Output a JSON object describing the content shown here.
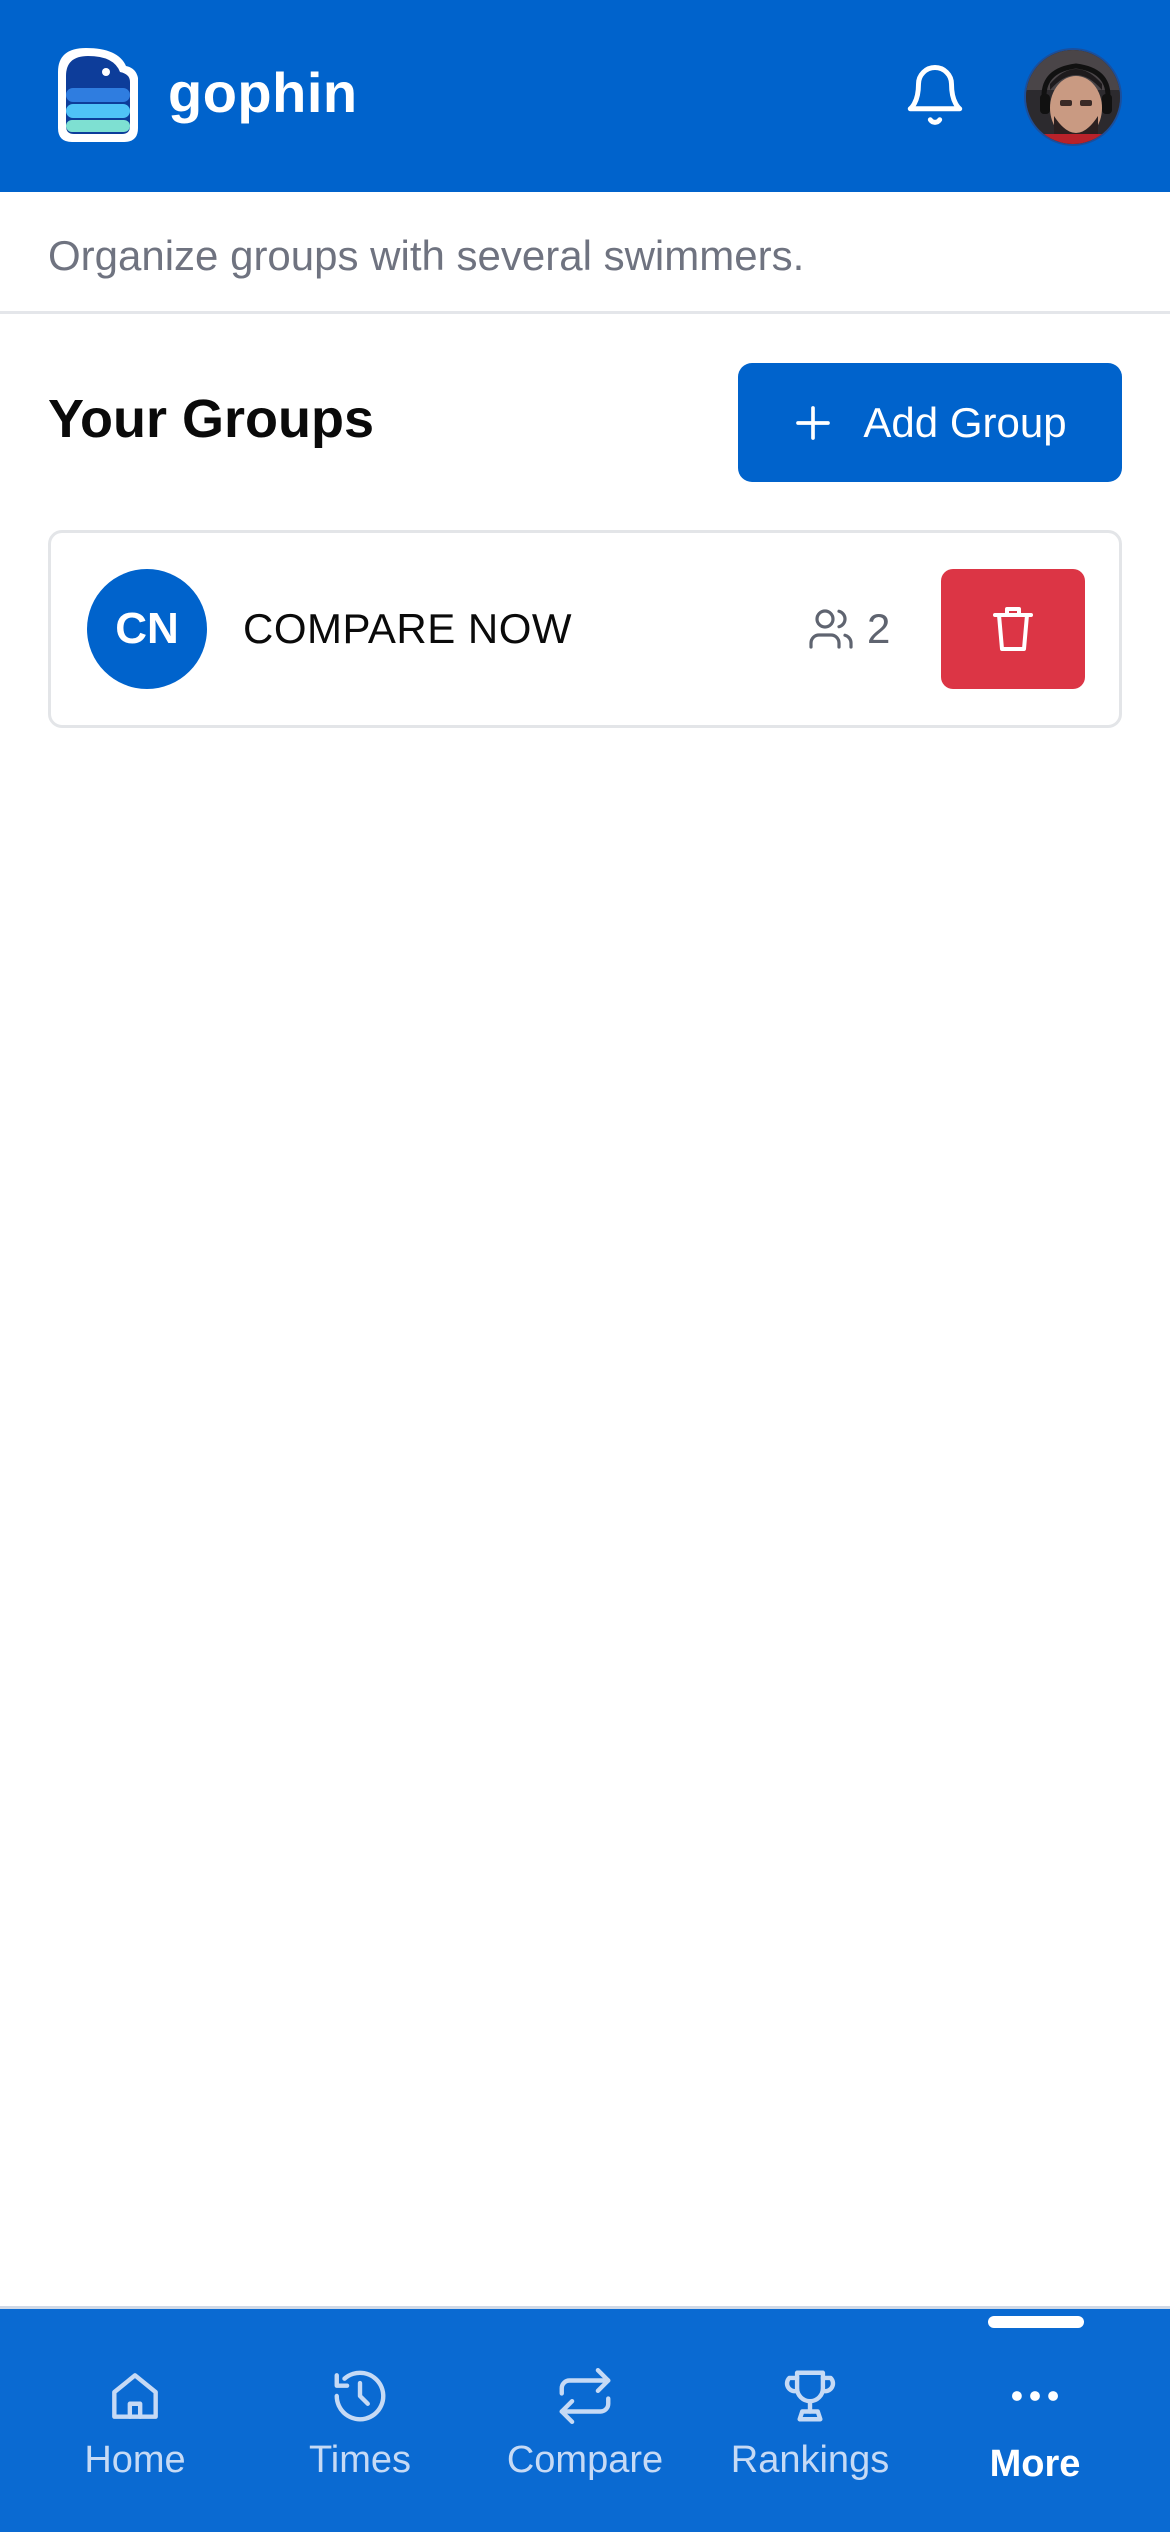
{
  "header": {
    "brand_name": "gophin",
    "colors": {
      "primary": "#0063cc",
      "danger": "#dc3545"
    }
  },
  "subtitle": "Organize groups with several swimmers.",
  "groups_section": {
    "title": "Your Groups",
    "add_button_label": "Add Group",
    "groups": [
      {
        "initials": "CN",
        "name": "COMPARE NOW",
        "member_count": "2"
      }
    ]
  },
  "bottom_nav": {
    "items": [
      {
        "label": "Home",
        "icon": "home-icon"
      },
      {
        "label": "Times",
        "icon": "history-icon"
      },
      {
        "label": "Compare",
        "icon": "compare-arrows-icon"
      },
      {
        "label": "Rankings",
        "icon": "trophy-icon"
      },
      {
        "label": "More",
        "icon": "more-dots-icon",
        "active": true
      }
    ]
  }
}
